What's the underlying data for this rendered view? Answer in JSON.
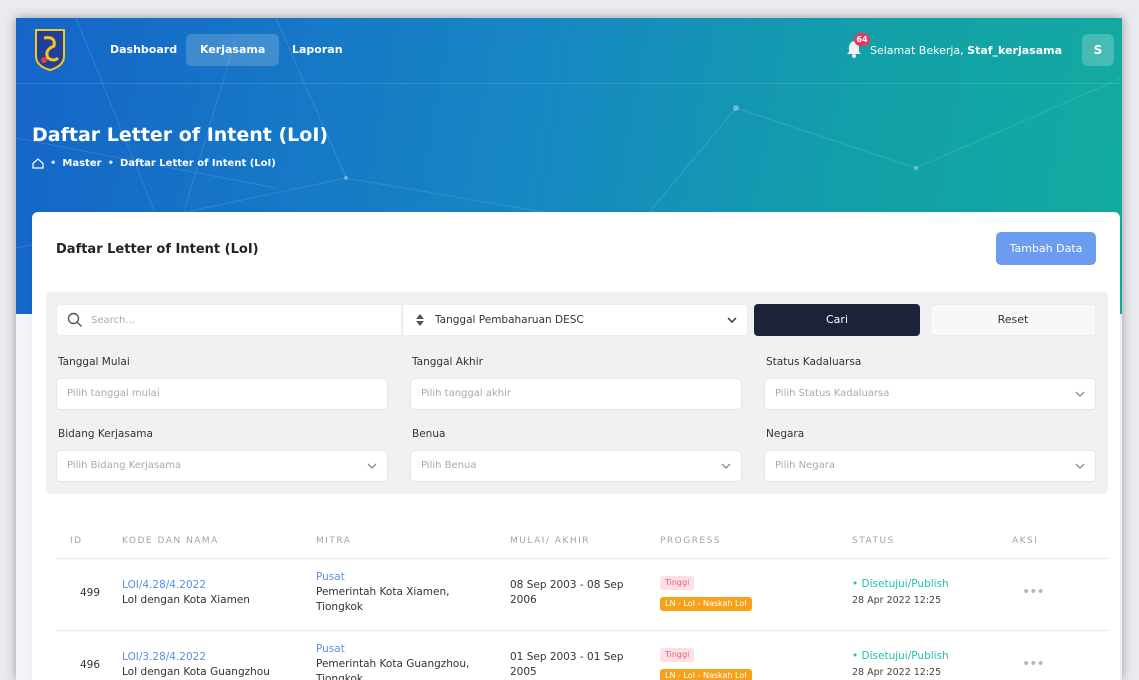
{
  "nav": {
    "items": [
      {
        "label": "Dashboard"
      },
      {
        "label": "Kerjasama"
      },
      {
        "label": "Laporan"
      }
    ],
    "notif_count": "64",
    "greeting_prefix": "Selamat Bekerja, ",
    "username": "Staf_kerjasama",
    "avatar_letter": "S"
  },
  "header": {
    "title": "Daftar Letter of Intent (LoI)",
    "breadcrumb": [
      "Master",
      "Daftar Letter of Intent (LoI)"
    ]
  },
  "card": {
    "title": "Daftar Letter of Intent (LoI)",
    "add_button": "Tambah Data"
  },
  "filters": {
    "search_placeholder": "Search...",
    "sort_value": "Tanggal Pembaharuan DESC",
    "search_button": "Cari",
    "reset_button": "Reset",
    "start_label": "Tanggal Mulai",
    "start_placeholder": "Pilih tanggal mulai",
    "end_label": "Tanggal Akhir",
    "end_placeholder": "Pilih tanggal akhir",
    "expiry_label": "Status Kadaluarsa",
    "expiry_placeholder": "Pilih Status Kadaluarsa",
    "field_label": "Bidang Kerjasama",
    "field_placeholder": "Pilih Bidang Kerjasama",
    "continent_label": "Benua",
    "continent_placeholder": "Pilih Benua",
    "country_label": "Negara",
    "country_placeholder": "Pilih Negara"
  },
  "table": {
    "columns": [
      "ID",
      "KODE DAN NAMA",
      "MITRA",
      "MULAI/ AKHIR",
      "PROGRESS",
      "STATUS",
      "AKSI"
    ],
    "rows": [
      {
        "id": "499",
        "code": "LOI/4.28/4.2022",
        "name": "LoI dengan Kota Xiamen",
        "partner_type": "Pusat",
        "partner": "Pemerintah Kota Xiamen, Tiongkok",
        "period": "08 Sep 2003 - 08 Sep 2006",
        "priority": "Tinggi",
        "stage": "LN - LoI - Naskah LoI",
        "status": "• Disetujui/Publish",
        "status_date": "28 Apr 2022 12:25",
        "action": "•••"
      },
      {
        "id": "496",
        "code": "LOI/3.28/4.2022",
        "name": "LoI dengan Kota Guangzhou",
        "partner_type": "Pusat",
        "partner": "Pemerintah Kota Guangzhou, Tiongkok",
        "period": "01 Sep 2003 - 01 Sep 2005",
        "priority": "Tinggi",
        "stage": "LN - LoI - Naskah LoI",
        "status": "• Disetujui/Publish",
        "status_date": "28 Apr 2022 12:25",
        "action": "•••"
      }
    ]
  },
  "colors": {
    "primary_dark": "#1c2237",
    "accent_blue": "#6b9cf0",
    "link": "#5a8fe6",
    "status_green": "#1fc2aa",
    "tag_orange": "#f7a11a"
  }
}
